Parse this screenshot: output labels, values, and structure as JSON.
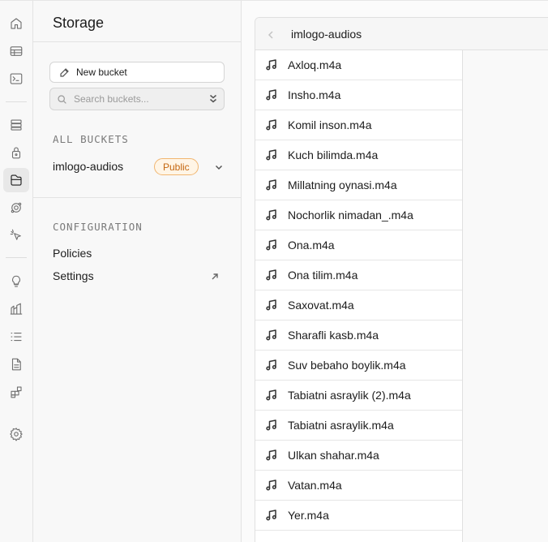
{
  "sidebar": {
    "title": "Storage",
    "new_bucket_label": "New bucket",
    "search_placeholder": "Search buckets...",
    "all_buckets_label": "ALL BUCKETS",
    "bucket": {
      "name": "imlogo-audios",
      "badge": "Public"
    },
    "configuration_label": "CONFIGURATION",
    "config_links": [
      "Policies",
      "Settings"
    ]
  },
  "rail_icons": [
    "home-icon",
    "table-editor-icon",
    "sql-editor-icon",
    "database-icon",
    "auth-icon",
    "storage-icon",
    "edge-functions-icon",
    "realtime-icon",
    "advisors-icon",
    "reports-icon",
    "logs-icon",
    "api-docs-icon",
    "integrations-icon",
    "settings-icon"
  ],
  "explorer": {
    "path": "imlogo-audios",
    "files": [
      "Axloq.m4a",
      "Insho.m4a",
      "Komil inson.m4a",
      "Kuch bilimda.m4a",
      "Millatning oynasi.m4a",
      "Nochorlik nimadan_.m4a",
      "Ona.m4a",
      "Ona tilim.m4a",
      "Saxovat.m4a",
      "Sharafli kasb.m4a",
      "Suv bebaho boylik.m4a",
      "Tabiatni asraylik (2).m4a",
      "Tabiatni asraylik.m4a",
      "Ulkan shahar.m4a",
      "Vatan.m4a",
      "Yer.m4a"
    ]
  },
  "colors": {
    "badge_border": "#f1b671",
    "badge_text": "#c4660f",
    "badge_bg": "#fff5e6"
  }
}
